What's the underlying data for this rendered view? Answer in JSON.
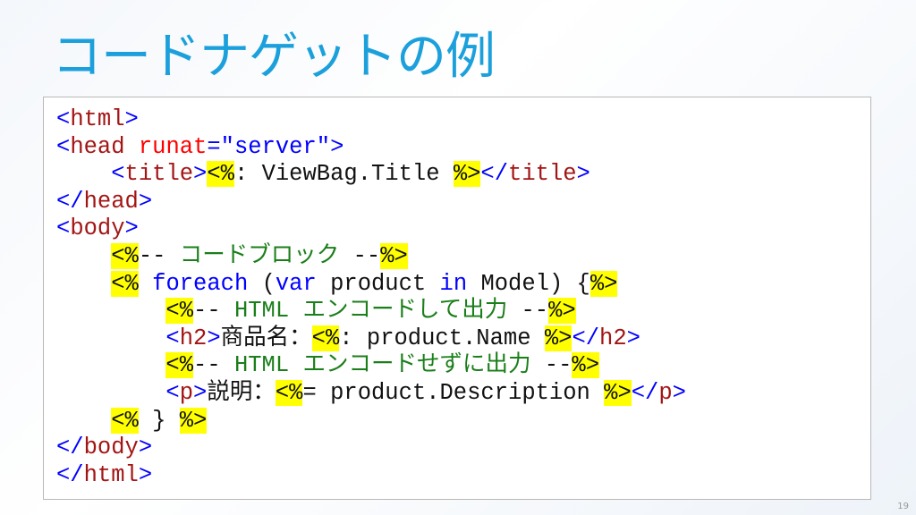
{
  "slide": {
    "title": "コードナゲットの例",
    "page_number": "19"
  },
  "code_lines": [
    [
      [
        "b",
        "<"
      ],
      [
        "t",
        "html"
      ],
      [
        "b",
        ">"
      ]
    ],
    [
      [
        "b",
        "<"
      ],
      [
        "t",
        "head"
      ],
      [
        "p",
        " "
      ],
      [
        "a",
        "runat"
      ],
      [
        "b",
        "="
      ],
      [
        "s",
        "\"server\""
      ],
      [
        "b",
        ">"
      ]
    ],
    [
      [
        "p",
        "    "
      ],
      [
        "b",
        "<"
      ],
      [
        "t",
        "title"
      ],
      [
        "b",
        ">"
      ],
      [
        "h",
        "<%"
      ],
      [
        "p",
        ": ViewBag.Title "
      ],
      [
        "h",
        "%>"
      ],
      [
        "b",
        "</"
      ],
      [
        "t",
        "title"
      ],
      [
        "b",
        ">"
      ]
    ],
    [
      [
        "b",
        "</"
      ],
      [
        "t",
        "head"
      ],
      [
        "b",
        ">"
      ]
    ],
    [
      [
        "b",
        "<"
      ],
      [
        "t",
        "body"
      ],
      [
        "b",
        ">"
      ]
    ],
    [
      [
        "p",
        "    "
      ],
      [
        "h",
        "<%"
      ],
      [
        "p",
        "-- "
      ],
      [
        "c",
        "コードブロック"
      ],
      [
        "p",
        " --"
      ],
      [
        "h",
        "%>"
      ]
    ],
    [
      [
        "p",
        "    "
      ],
      [
        "h",
        "<%"
      ],
      [
        "p",
        " "
      ],
      [
        "k",
        "foreach"
      ],
      [
        "p",
        " ("
      ],
      [
        "k",
        "var"
      ],
      [
        "p",
        " product "
      ],
      [
        "k",
        "in"
      ],
      [
        "p",
        " Model) {"
      ],
      [
        "h",
        "%>"
      ]
    ],
    [
      [
        "p",
        "        "
      ],
      [
        "h",
        "<%"
      ],
      [
        "p",
        "-- "
      ],
      [
        "c",
        "HTML エンコードして出力"
      ],
      [
        "p",
        " --"
      ],
      [
        "h",
        "%>"
      ]
    ],
    [
      [
        "p",
        "        "
      ],
      [
        "b",
        "<"
      ],
      [
        "t",
        "h2"
      ],
      [
        "b",
        ">"
      ],
      [
        "p",
        "商品名："
      ],
      [
        "h",
        "<%"
      ],
      [
        "p",
        ": product.Name "
      ],
      [
        "h",
        "%>"
      ],
      [
        "b",
        "</"
      ],
      [
        "t",
        "h2"
      ],
      [
        "b",
        ">"
      ]
    ],
    [
      [
        "p",
        "        "
      ],
      [
        "h",
        "<%"
      ],
      [
        "p",
        "-- "
      ],
      [
        "c",
        "HTML エンコードせずに出力"
      ],
      [
        "p",
        " --"
      ],
      [
        "h",
        "%>"
      ]
    ],
    [
      [
        "p",
        "        "
      ],
      [
        "b",
        "<"
      ],
      [
        "t",
        "p"
      ],
      [
        "b",
        ">"
      ],
      [
        "p",
        "説明："
      ],
      [
        "h",
        "<%"
      ],
      [
        "p",
        "= product.Description "
      ],
      [
        "h",
        "%>"
      ],
      [
        "b",
        "</"
      ],
      [
        "t",
        "p"
      ],
      [
        "b",
        ">"
      ]
    ],
    [
      [
        "p",
        "    "
      ],
      [
        "h",
        "<%"
      ],
      [
        "p",
        " } "
      ],
      [
        "h",
        "%>"
      ]
    ],
    [
      [
        "b",
        "</"
      ],
      [
        "t",
        "body"
      ],
      [
        "b",
        ">"
      ]
    ],
    [
      [
        "b",
        "</"
      ],
      [
        "t",
        "html"
      ],
      [
        "b",
        ">"
      ]
    ]
  ]
}
